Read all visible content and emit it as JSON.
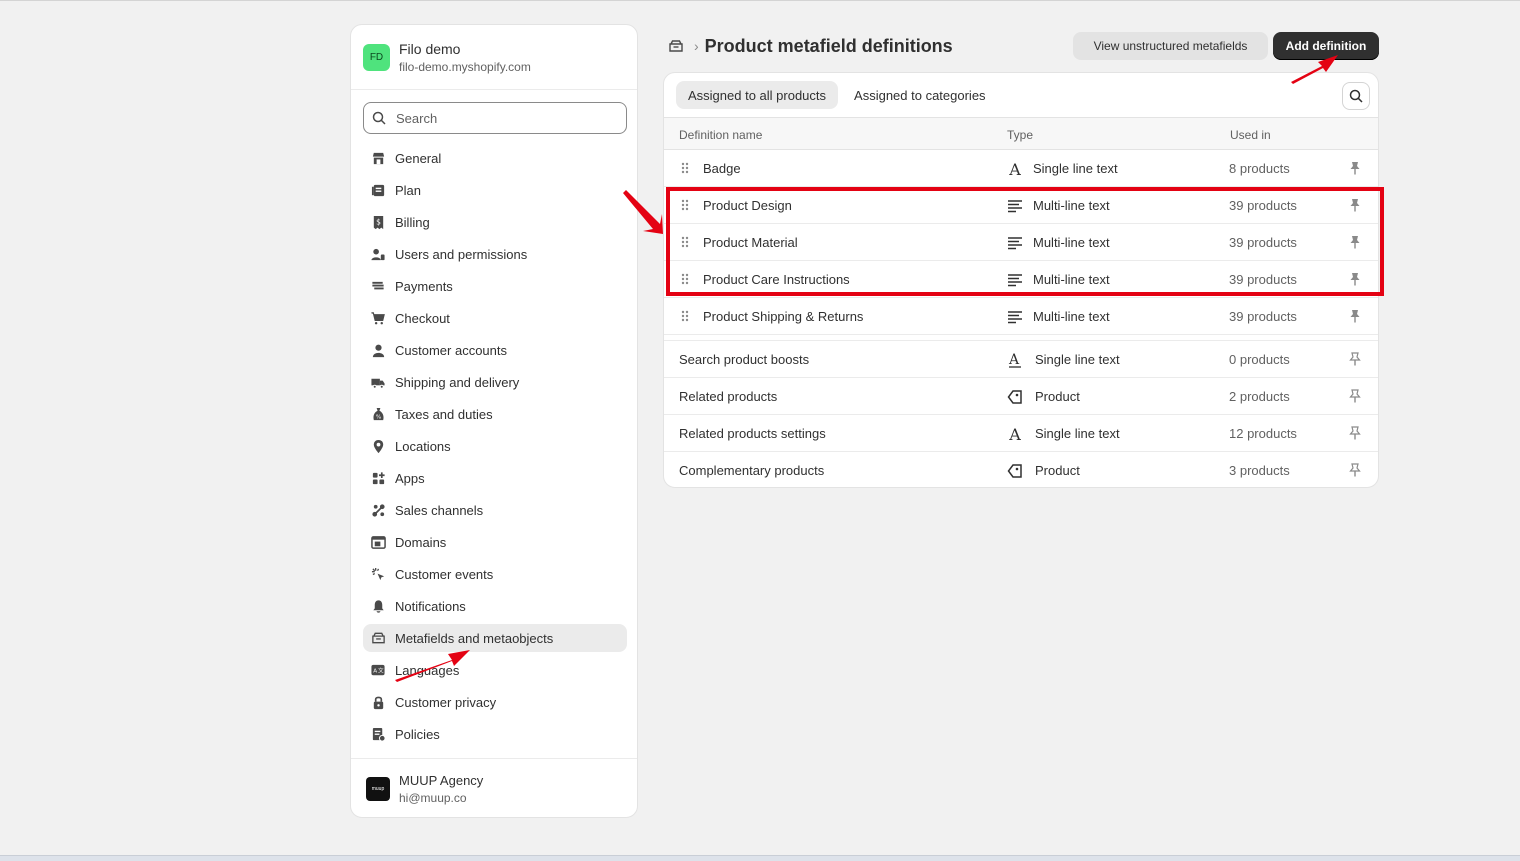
{
  "store": {
    "initials": "FD",
    "name": "Filo demo",
    "url": "filo-demo.myshopify.com"
  },
  "search": {
    "placeholder": "Search"
  },
  "nav": [
    {
      "label": "General",
      "icon": "store-icon"
    },
    {
      "label": "Plan",
      "icon": "plan-icon"
    },
    {
      "label": "Billing",
      "icon": "billing-icon"
    },
    {
      "label": "Users and permissions",
      "icon": "users-icon"
    },
    {
      "label": "Payments",
      "icon": "payments-icon"
    },
    {
      "label": "Checkout",
      "icon": "cart-icon"
    },
    {
      "label": "Customer accounts",
      "icon": "person-icon"
    },
    {
      "label": "Shipping and delivery",
      "icon": "truck-icon"
    },
    {
      "label": "Taxes and duties",
      "icon": "tax-icon"
    },
    {
      "label": "Locations",
      "icon": "location-icon"
    },
    {
      "label": "Apps",
      "icon": "apps-icon"
    },
    {
      "label": "Sales channels",
      "icon": "sales-channels-icon"
    },
    {
      "label": "Domains",
      "icon": "domains-icon"
    },
    {
      "label": "Customer events",
      "icon": "cursor-icon"
    },
    {
      "label": "Notifications",
      "icon": "bell-icon"
    },
    {
      "label": "Metafields and metaobjects",
      "icon": "metafields-icon",
      "active": true
    },
    {
      "label": "Languages",
      "icon": "languages-icon"
    },
    {
      "label": "Customer privacy",
      "icon": "lock-icon"
    },
    {
      "label": "Policies",
      "icon": "policies-icon"
    }
  ],
  "account": {
    "logo_text": "muup",
    "name": "MUUP Agency",
    "email": "hi@muup.co"
  },
  "header": {
    "title": "Product metafield definitions",
    "secondary_button": "View unstructured metafields",
    "primary_button": "Add definition"
  },
  "tabs": [
    {
      "label": "Assigned to all products",
      "active": true
    },
    {
      "label": "Assigned to categories",
      "active": false
    }
  ],
  "table": {
    "columns": {
      "name": "Definition name",
      "type": "Type",
      "used": "Used in"
    },
    "pinned_rows": [
      {
        "name": "Badge",
        "type": "Single line text",
        "type_icon": "single-line-text-icon",
        "used": "8 products"
      },
      {
        "name": "Product Design",
        "type": "Multi-line text",
        "type_icon": "multi-line-text-icon",
        "used": "39 products"
      },
      {
        "name": "Product Material",
        "type": "Multi-line text",
        "type_icon": "multi-line-text-icon",
        "used": "39 products"
      },
      {
        "name": "Product Care Instructions",
        "type": "Multi-line text",
        "type_icon": "multi-line-text-icon",
        "used": "39 products"
      },
      {
        "name": "Product Shipping & Returns",
        "type": "Multi-line text",
        "type_icon": "multi-line-text-icon",
        "used": "39 products"
      }
    ],
    "unpinned_rows": [
      {
        "name": "Search product boosts",
        "type": "Single line text",
        "type_icon": "single-line-text-list-icon",
        "used": "0 products"
      },
      {
        "name": "Related products",
        "type": "Product",
        "type_icon": "product-tag-icon",
        "used": "2 products"
      },
      {
        "name": "Related products settings",
        "type": "Single line text",
        "type_icon": "single-line-text-icon",
        "used": "12 products"
      },
      {
        "name": "Complementary products",
        "type": "Product",
        "type_icon": "product-tag-icon",
        "used": "3 products"
      }
    ]
  },
  "colors": {
    "annotation": "#e40213",
    "primary_button": "#303030",
    "store_avatar": "#4fe37d"
  }
}
